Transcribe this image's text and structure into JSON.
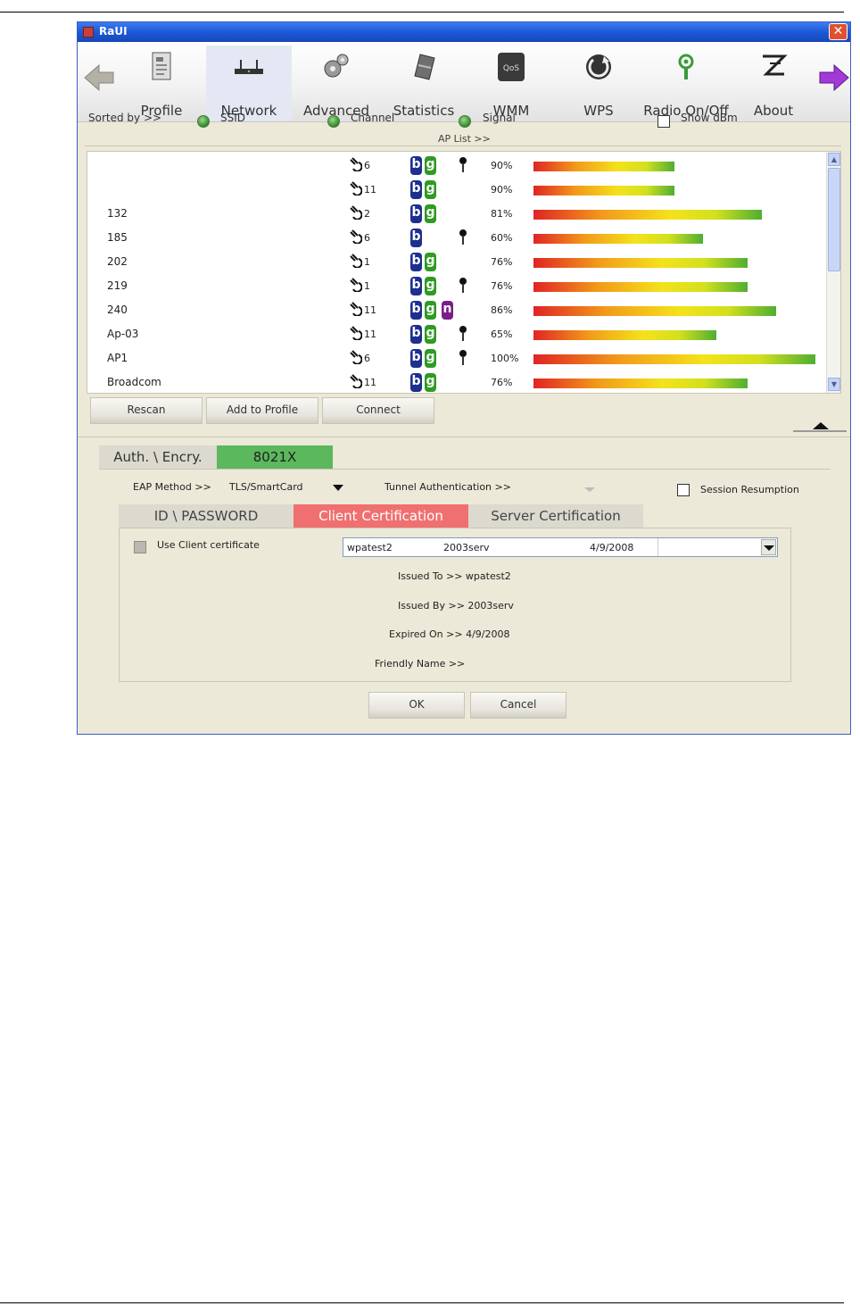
{
  "window": {
    "title": "RaUI"
  },
  "toolbar": {
    "items": [
      {
        "label": "Profile",
        "icon": "profile-icon"
      },
      {
        "label": "Network",
        "icon": "network-icon"
      },
      {
        "label": "Advanced",
        "icon": "gears-icon"
      },
      {
        "label": "Statistics",
        "icon": "statistics-icon"
      },
      {
        "label": "WMM",
        "icon": "wmm-icon"
      },
      {
        "label": "WPS",
        "icon": "wps-icon"
      },
      {
        "label": "Radio On/Off",
        "icon": "radio-icon"
      },
      {
        "label": "About",
        "icon": "about-icon"
      }
    ],
    "active": "Network"
  },
  "sort": {
    "label": "Sorted by >>",
    "ssid": "SSID",
    "channel": "Channel",
    "signal": "Signal",
    "show_dbm": "Show dBm"
  },
  "ap_list": {
    "label": "AP List >>",
    "rows": [
      {
        "ssid": "",
        "channel": "6",
        "modes": [
          "b",
          "g"
        ],
        "secured": true,
        "signal": "90%",
        "signal_value": 50
      },
      {
        "ssid": "",
        "channel": "11",
        "modes": [
          "b",
          "g"
        ],
        "secured": false,
        "signal": "90%",
        "signal_value": 50
      },
      {
        "ssid": "132",
        "channel": "2",
        "modes": [
          "b",
          "g"
        ],
        "secured": false,
        "signal": "81%",
        "signal_value": 81
      },
      {
        "ssid": "185",
        "channel": "6",
        "modes": [
          "b"
        ],
        "secured": true,
        "signal": "60%",
        "signal_value": 60
      },
      {
        "ssid": "202",
        "channel": "1",
        "modes": [
          "b",
          "g"
        ],
        "secured": false,
        "signal": "76%",
        "signal_value": 76
      },
      {
        "ssid": "219",
        "channel": "1",
        "modes": [
          "b",
          "g"
        ],
        "secured": true,
        "signal": "76%",
        "signal_value": 76
      },
      {
        "ssid": "240",
        "channel": "11",
        "modes": [
          "b",
          "g",
          "n"
        ],
        "secured": false,
        "signal": "86%",
        "signal_value": 86
      },
      {
        "ssid": "Ap-03",
        "channel": "11",
        "modes": [
          "b",
          "g"
        ],
        "secured": true,
        "signal": "65%",
        "signal_value": 65
      },
      {
        "ssid": "AP1",
        "channel": "6",
        "modes": [
          "b",
          "g"
        ],
        "secured": true,
        "signal": "100%",
        "signal_value": 100
      },
      {
        "ssid": "Broadcom",
        "channel": "11",
        "modes": [
          "b",
          "g"
        ],
        "secured": false,
        "signal": "76%",
        "signal_value": 76
      }
    ]
  },
  "buttons": {
    "rescan": "Rescan",
    "add_to_profile": "Add to Profile",
    "connect": "Connect",
    "ok": "OK",
    "cancel": "Cancel"
  },
  "auth": {
    "label": "Auth. \\ Encry.",
    "value": "8021X",
    "eap_method_label": "EAP Method >>",
    "eap_method_value": "TLS/SmartCard",
    "tunnel_auth_label": "Tunnel Authentication >>",
    "session_resumption": "Session Resumption"
  },
  "tabs": {
    "id_password": "ID \\ PASSWORD",
    "client_cert": "Client Certification",
    "server_cert": "Server Certification",
    "active": "Client Certification"
  },
  "client_cert": {
    "use_client_cert": "Use Client certificate",
    "combo": {
      "issued_to": "wpatest2",
      "issued_by": "2003serv",
      "expired_on": "4/9/2008"
    },
    "issued_to": "Issued To >> wpatest2",
    "issued_by": "Issued By >> 2003serv",
    "expired_on": "Expired On >> 4/9/2008",
    "friendly_name": "Friendly Name >>"
  },
  "colors": {
    "accent_green": "#5cb85c",
    "active_tab": "#f07070",
    "titlebar": "#1c58d8"
  }
}
